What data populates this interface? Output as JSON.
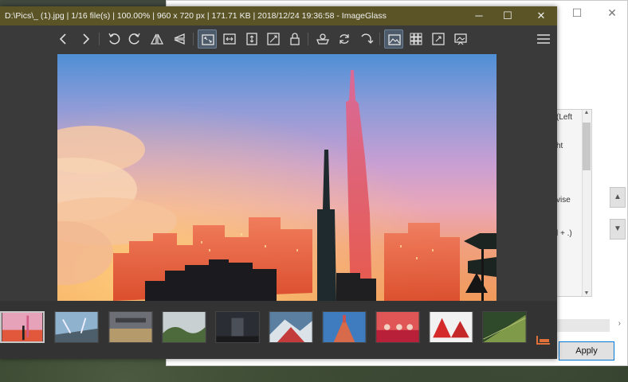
{
  "background_dialog": {
    "list_fragments": [
      "(Left",
      "ht",
      "vise",
      "l + .)"
    ],
    "apply_label": "Apply"
  },
  "window": {
    "title": "D:\\Pics\\_ (1).jpg  |  1/16 file(s)  |  100.00%  |  960 x 720 px  |  171.71 KB  |  2018/12/24 19:36:58  -  ImageGlass",
    "title_bar_color": "#5a5426"
  },
  "toolbar": {
    "active_tool_icons": [
      "auto-zoom-icon",
      "thumbnail-bar-icon"
    ],
    "buttons": [
      "previous-icon",
      "next-icon",
      "rotate-left-icon",
      "rotate-right-icon",
      "flip-horizontal-icon",
      "flip-vertical-icon",
      "auto-zoom-icon",
      "scale-to-width-icon",
      "scale-to-height-icon",
      "scale-to-fit-icon",
      "lock-zoom-icon",
      "fill-icon",
      "refresh-icon",
      "goto-icon",
      "thumbnail-bar-icon",
      "grid-icon",
      "fullscreen-icon",
      "slideshow-icon",
      "menu-icon"
    ]
  },
  "thumbnails": {
    "count_shown": 10,
    "selected_index": 0
  }
}
